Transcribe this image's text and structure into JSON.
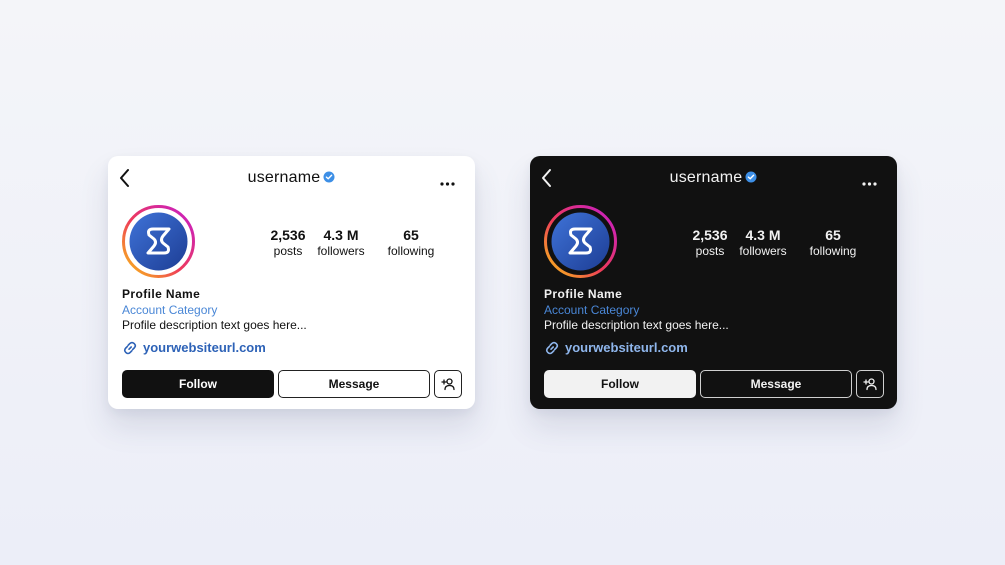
{
  "cards": [
    {
      "theme": "light",
      "username": "username",
      "stats": [
        {
          "value": "2,536",
          "label": "posts"
        },
        {
          "value": "4.3 M",
          "label": "followers"
        },
        {
          "value": "65",
          "label": "following"
        }
      ],
      "profile_name": "Profile Name",
      "category": "Account Category",
      "description": "Profile description text goes here...",
      "website": "yourwebsiteurl.com",
      "buttons": {
        "follow": "Follow",
        "message": "Message"
      }
    },
    {
      "theme": "dark",
      "username": "username",
      "stats": [
        {
          "value": "2,536",
          "label": "posts"
        },
        {
          "value": "4.3 M",
          "label": "followers"
        },
        {
          "value": "65",
          "label": "following"
        }
      ],
      "profile_name": "Profile Name",
      "category": "Account Category",
      "description": "Profile description text goes here...",
      "website": "yourwebsiteurl.com",
      "buttons": {
        "follow": "Follow",
        "message": "Message"
      }
    }
  ],
  "icons": {
    "back": "chevron-left-icon",
    "verified": "verified-badge-icon",
    "more": "more-horizontal-icon",
    "link": "link-icon",
    "add_user": "add-user-icon",
    "logo": "s-logo-icon"
  },
  "colors": {
    "verified": "#3d8fe6",
    "link_light": "#2d62b7",
    "category": "#4a87d6",
    "avatar_ring_start": "#f9c513",
    "avatar_ring_end": "#c41ccf",
    "avatar_bg": "#2a55b5"
  }
}
